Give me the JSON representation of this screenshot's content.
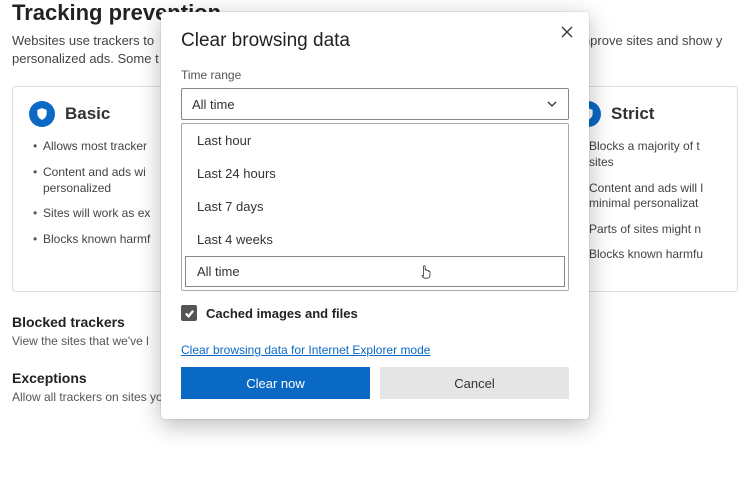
{
  "page": {
    "title": "Tracking prevention",
    "desc_pre": "Websites use trackers to",
    "desc_post": "mprove sites and show y",
    "desc_line2": "personalized ads. Some t"
  },
  "cards": {
    "basic": {
      "title": "Basic",
      "bullets": [
        "Allows most tracker",
        "Content and ads wi\npersonalized",
        "Sites will work as ex",
        "Blocks known harmf"
      ]
    },
    "strict": {
      "title": "Strict",
      "bullets": [
        "Blocks a majority of t\nsites",
        "Content and ads will l\nminimal personalizat",
        "Parts of sites might n",
        "Blocks known harmfu"
      ]
    }
  },
  "sections": {
    "blocked_title": "Blocked trackers",
    "blocked_sub": "View the sites that we've l",
    "exceptions_title": "Exceptions",
    "exceptions_sub": "Allow all trackers on sites you choose"
  },
  "dialog": {
    "title": "Clear browsing data",
    "time_range_label": "Time range",
    "selected": "All time",
    "options": [
      "Last hour",
      "Last 24 hours",
      "Last 7 days",
      "Last 4 weeks",
      "All time"
    ],
    "checkbox_label": "Cached images and files",
    "ie_link": "Clear browsing data for Internet Explorer mode",
    "clear_btn": "Clear now",
    "cancel_btn": "Cancel"
  }
}
